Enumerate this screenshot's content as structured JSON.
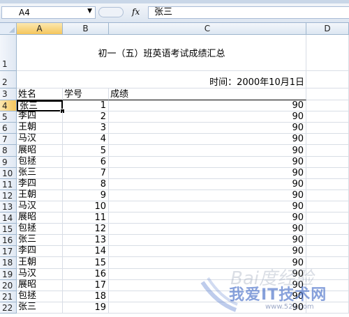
{
  "formula_bar": {
    "name_box": "A4",
    "fx_label": "fx",
    "formula_value": "张三"
  },
  "columns": [
    "A",
    "B",
    "C",
    "D"
  ],
  "title": "初一（五）班英语考试成绩汇总",
  "date_text": "时间：2000年10月1日",
  "headers": {
    "name": "姓名",
    "id": "学号",
    "score": "成绩"
  },
  "rows": [
    {
      "row": "4",
      "name": "张三",
      "id": "1",
      "score": "90"
    },
    {
      "row": "5",
      "name": "李四",
      "id": "2",
      "score": "90"
    },
    {
      "row": "6",
      "name": "王朝",
      "id": "3",
      "score": "90"
    },
    {
      "row": "7",
      "name": "马汉",
      "id": "4",
      "score": "90"
    },
    {
      "row": "8",
      "name": "展昭",
      "id": "5",
      "score": "90"
    },
    {
      "row": "9",
      "name": "包拯",
      "id": "6",
      "score": "90"
    },
    {
      "row": "10",
      "name": "张三",
      "id": "7",
      "score": "90"
    },
    {
      "row": "11",
      "name": "李四",
      "id": "8",
      "score": "90"
    },
    {
      "row": "12",
      "name": "王朝",
      "id": "9",
      "score": "90"
    },
    {
      "row": "13",
      "name": "马汉",
      "id": "10",
      "score": "90"
    },
    {
      "row": "14",
      "name": "展昭",
      "id": "11",
      "score": "90"
    },
    {
      "row": "15",
      "name": "包拯",
      "id": "12",
      "score": "90"
    },
    {
      "row": "16",
      "name": "张三",
      "id": "13",
      "score": "90"
    },
    {
      "row": "17",
      "name": "李四",
      "id": "14",
      "score": "90"
    },
    {
      "row": "18",
      "name": "王朝",
      "id": "15",
      "score": "90"
    },
    {
      "row": "19",
      "name": "马汉",
      "id": "16",
      "score": "90"
    },
    {
      "row": "20",
      "name": "展昭",
      "id": "17",
      "score": "90"
    },
    {
      "row": "21",
      "name": "包拯",
      "id": "18",
      "score": "90"
    },
    {
      "row": "22",
      "name": "张三",
      "id": "19",
      "score": "90"
    }
  ],
  "row_labels_top": [
    "1",
    "2",
    "3"
  ],
  "watermark": {
    "baidu": "Bai度经验",
    "main": "我爱IT技术网",
    "url": "www.52ij.com"
  }
}
